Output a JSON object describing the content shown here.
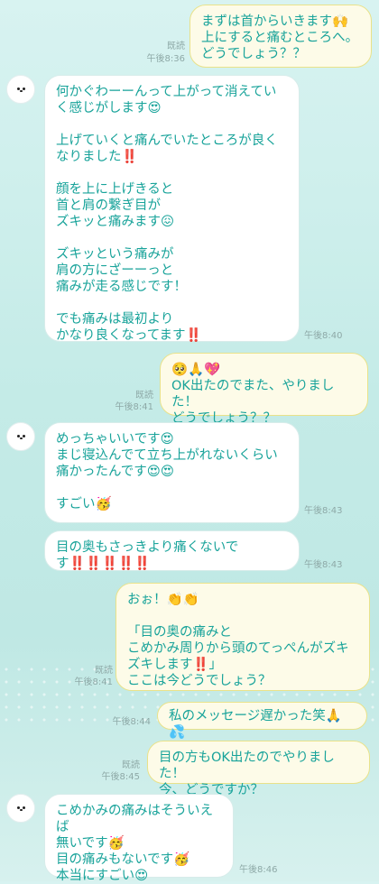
{
  "messages": [
    {
      "id": "m1",
      "text": "まずは首からいきます🙌\n上にすると痛むところへ。\nどうでしょう？？",
      "read": "既読",
      "time": "午後8:36"
    },
    {
      "id": "m2",
      "text": "何かぐわーーんって上がって消えていく感じがします😍\n\n上げていくと痛んでいたところが良くなりました‼️\n\n顔を上に上げきると\n首と肩の繋ぎ目が\nズキッと痛みます😖\n\nズキッという痛みが\n肩の方にざーーっと\n痛みが走る感じです！\n\nでも痛みは最初より\nかなり良くなってます‼️",
      "time": "午後8:40"
    },
    {
      "id": "m3",
      "text": "🥺🙏💖\nOK出たのでまた、やりました！\nどうでしょう？？",
      "read": "既読",
      "time": "午後8:41"
    },
    {
      "id": "m4",
      "text": "めっちゃいいです😍\nまじ寝込んでて立ち上がれないくらい痛かったんです😍😍\n\nすごい🥳",
      "time": "午後8:43"
    },
    {
      "id": "m5",
      "text": "目の奥もさっきより痛くないです‼️‼️‼️‼️‼️",
      "time": "午後8:43"
    },
    {
      "id": "m6",
      "text": "おぉ！👏👏\n\n「目の奥の痛みと\nこめかみ周りから頭のてっぺんがズキズキします‼️」\nここは今どうでしょう？",
      "read": "既読",
      "time": "午後8:41"
    },
    {
      "id": "m7",
      "text": "私のメッセージ遅かった笑🙏💦",
      "time": "午後8:44"
    },
    {
      "id": "m8",
      "text": "目の方もOK出たのでやりました！\n今、どうですか？",
      "read": "既読",
      "time": "午後8:45"
    },
    {
      "id": "m9",
      "text": "こめかみの痛みはそういえば\n無いです🥳\n目の痛みもないです🥳\n本当にすごい😍",
      "time": "午後8:46"
    }
  ]
}
